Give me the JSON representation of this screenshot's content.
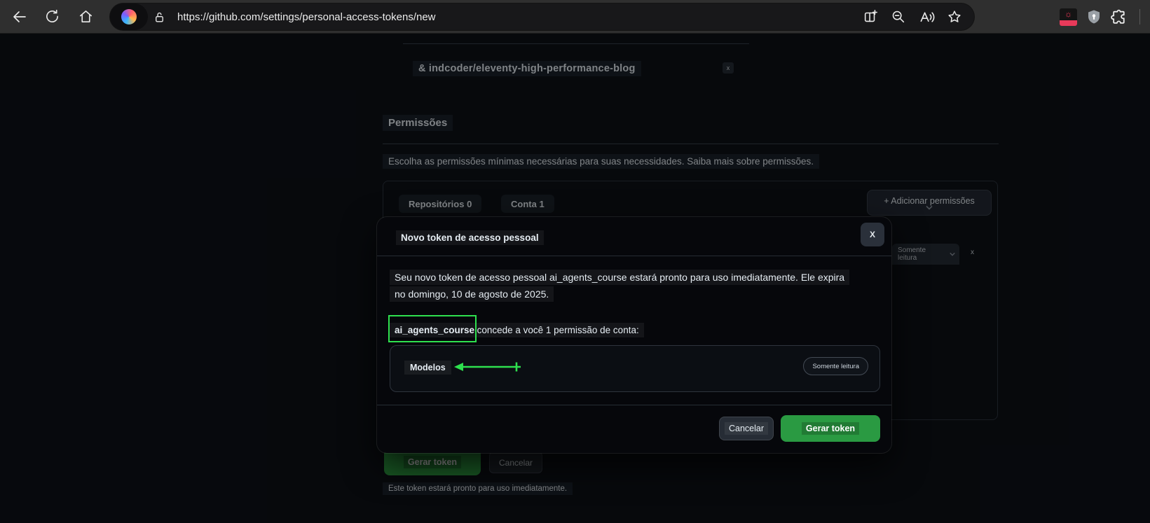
{
  "browser": {
    "url": "https://github.com/settings/personal-access-tokens/new",
    "toolbar_icons": [
      "back",
      "reload",
      "home",
      "copilot",
      "lock",
      "split-screen",
      "zoom-out",
      "read-aloud",
      "favorite-star",
      "screenshot-extension",
      "privacy-shield",
      "extensions-puzzle"
    ]
  },
  "page": {
    "repo_tag": "& indcoder/eleventy-high-performance-blog",
    "repo_tag_remove": "x",
    "permissions_heading": "Permissões",
    "permissions_description": "Escolha as permissões mínimas necessárias para suas necessidades. Saiba mais sobre permissões.",
    "tabs": [
      {
        "label": "Repositórios 0"
      },
      {
        "label": "Conta 1"
      }
    ],
    "add_permissions_button": "+ Adicionar permissões",
    "selected_permission_level": "Somente leitura",
    "selected_permission_remove": "x",
    "generate_button": "Gerar token",
    "cancel_button": "Cancelar",
    "footnote": "Este token estará pronto para uso imediatamente."
  },
  "modal": {
    "title": "Novo token de acesso pessoal",
    "close_label": "X",
    "body_line1": "Seu novo token de acesso pessoal ai_agents_course estará pronto para uso imediatamente. Ele expira",
    "body_line2": "no domingo, 10 de agosto de 2025.",
    "token_name": "ai_agents_course",
    "permission_intro_rest": "|concede a você 1 permissão de conta:",
    "permission_name": "Modelos",
    "permission_level": "Somente leitura",
    "cancel_button": "Cancelar",
    "generate_button": "Gerar token"
  },
  "colors": {
    "annotation_green": "#2ee04e",
    "primary_button_green": "#2a9a42",
    "page_background": "#0d1117",
    "modal_background": "#06070b",
    "toolbar_background": "#2f2f2f"
  }
}
